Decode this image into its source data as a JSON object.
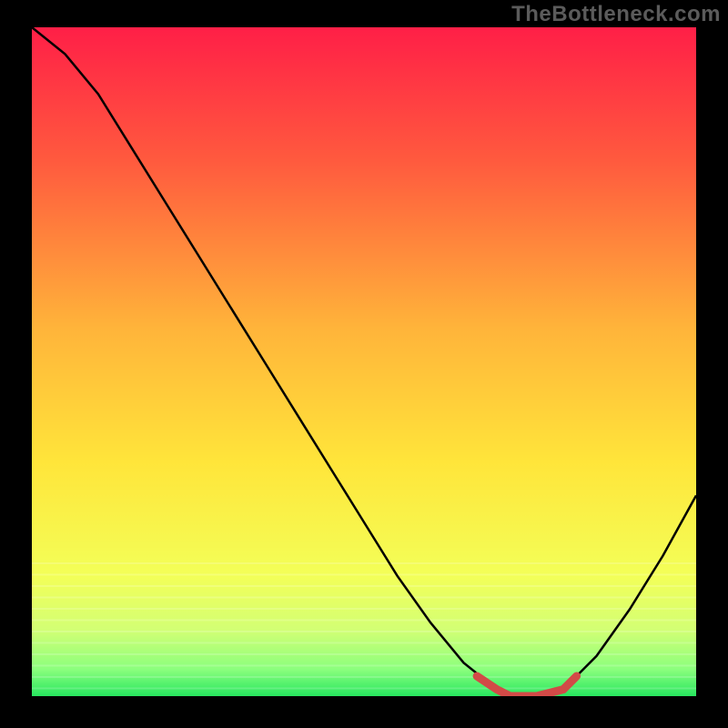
{
  "watermark": "TheBottleneck.com",
  "chart_data": {
    "type": "line",
    "title": "",
    "xlabel": "",
    "ylabel": "",
    "xlim": [
      0,
      100
    ],
    "ylim": [
      0,
      100
    ],
    "series": [
      {
        "name": "bottleneck-curve",
        "x": [
          0,
          5,
          10,
          15,
          20,
          25,
          30,
          35,
          40,
          45,
          50,
          55,
          60,
          65,
          70,
          72,
          76,
          80,
          85,
          90,
          95,
          100
        ],
        "values": [
          100,
          96,
          90,
          82,
          74,
          66,
          58,
          50,
          42,
          34,
          26,
          18,
          11,
          5,
          1,
          0,
          0,
          1,
          6,
          13,
          21,
          30
        ]
      }
    ],
    "highlight_segment": {
      "name": "optimal-zone",
      "color": "#d24a47",
      "x": [
        67,
        70,
        72,
        76,
        80,
        82
      ],
      "values": [
        3,
        1,
        0,
        0,
        1,
        3
      ]
    },
    "background_gradient": {
      "stops": [
        {
          "offset": 0,
          "color": "#ff1f47"
        },
        {
          "offset": 0.2,
          "color": "#ff5a3e"
        },
        {
          "offset": 0.45,
          "color": "#ffb43a"
        },
        {
          "offset": 0.65,
          "color": "#ffe53a"
        },
        {
          "offset": 0.82,
          "color": "#f3ff58"
        },
        {
          "offset": 0.9,
          "color": "#d3ff74"
        },
        {
          "offset": 0.96,
          "color": "#8bff7d"
        },
        {
          "offset": 1.0,
          "color": "#27e65f"
        }
      ]
    }
  }
}
